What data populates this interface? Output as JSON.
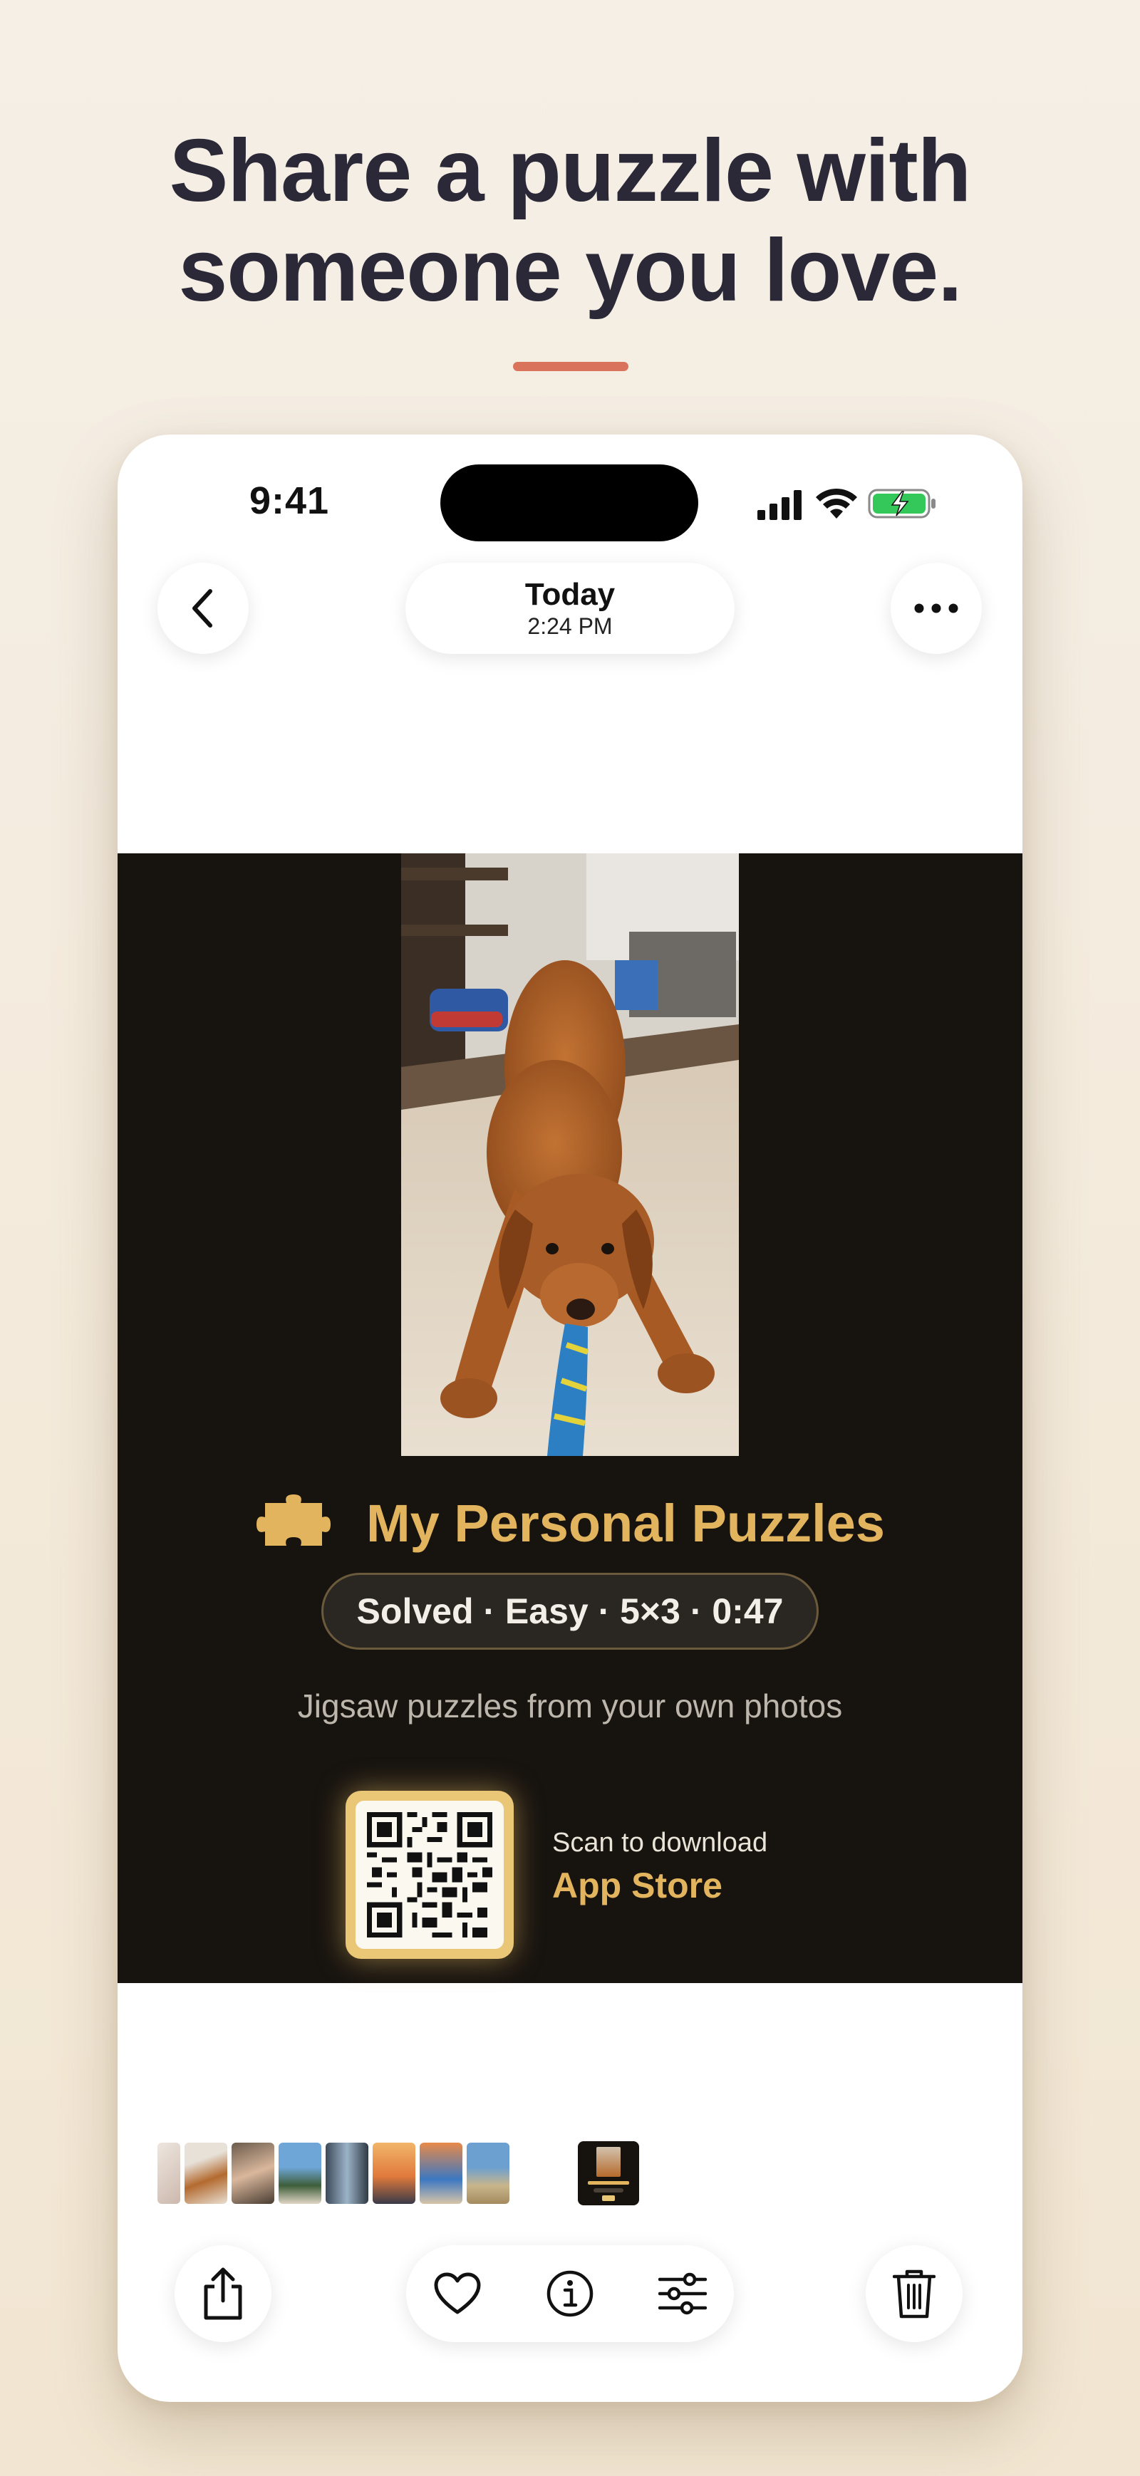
{
  "headline": {
    "line1": "Share a puzzle with",
    "line2": "someone you love."
  },
  "colors": {
    "accent_bar": "#d9735c",
    "brand_gold": "#e3b45e",
    "card_background": "#17130f",
    "headline": "#2b2838"
  },
  "status_bar": {
    "time": "9:41",
    "icons": [
      "cellular-signal-icon",
      "wifi-icon",
      "battery-charging-icon"
    ]
  },
  "nav": {
    "back_icon": "chevron-left-icon",
    "date_title": "Today",
    "date_time": "2:24 PM",
    "more_icon": "ellipsis-icon"
  },
  "share_card": {
    "photo_subject": "dog",
    "brand_icon": "puzzle-piece-icon",
    "brand_title": "My Personal Puzzles",
    "stats": "Solved · Easy · 5×3 · 0:47",
    "tagline": "Jigsaw puzzles from your own photos",
    "qr_icon": "qr-code-icon",
    "qr_caption": "Scan to download",
    "qr_cta": "App Store"
  },
  "filmstrip": {
    "thumbnail_count": 10
  },
  "toolbar": {
    "share_icon": "share-icon",
    "favorite_icon": "heart-icon",
    "info_icon": "info-icon",
    "adjust_icon": "sliders-icon",
    "delete_icon": "trash-icon"
  }
}
